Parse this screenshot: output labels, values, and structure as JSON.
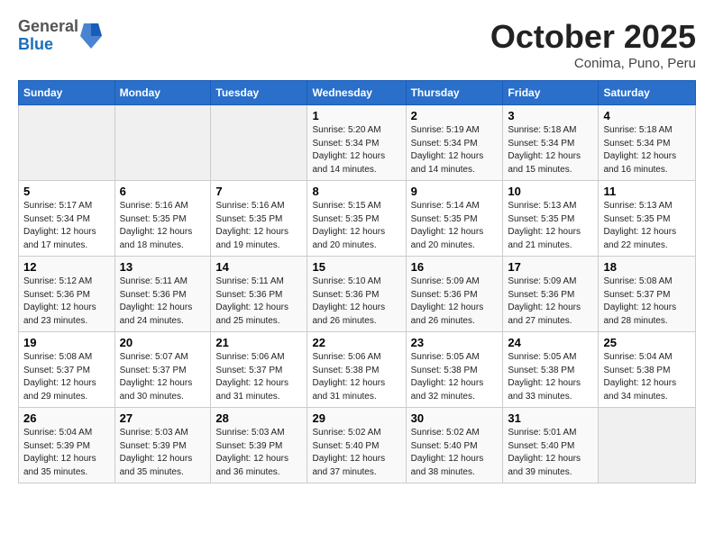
{
  "header": {
    "logo_general": "General",
    "logo_blue": "Blue",
    "month_title": "October 2025",
    "location": "Conima, Puno, Peru"
  },
  "calendar": {
    "days_of_week": [
      "Sunday",
      "Monday",
      "Tuesday",
      "Wednesday",
      "Thursday",
      "Friday",
      "Saturday"
    ],
    "weeks": [
      [
        {
          "day": "",
          "info": ""
        },
        {
          "day": "",
          "info": ""
        },
        {
          "day": "",
          "info": ""
        },
        {
          "day": "1",
          "info": "Sunrise: 5:20 AM\nSunset: 5:34 PM\nDaylight: 12 hours\nand 14 minutes."
        },
        {
          "day": "2",
          "info": "Sunrise: 5:19 AM\nSunset: 5:34 PM\nDaylight: 12 hours\nand 14 minutes."
        },
        {
          "day": "3",
          "info": "Sunrise: 5:18 AM\nSunset: 5:34 PM\nDaylight: 12 hours\nand 15 minutes."
        },
        {
          "day": "4",
          "info": "Sunrise: 5:18 AM\nSunset: 5:34 PM\nDaylight: 12 hours\nand 16 minutes."
        }
      ],
      [
        {
          "day": "5",
          "info": "Sunrise: 5:17 AM\nSunset: 5:34 PM\nDaylight: 12 hours\nand 17 minutes."
        },
        {
          "day": "6",
          "info": "Sunrise: 5:16 AM\nSunset: 5:35 PM\nDaylight: 12 hours\nand 18 minutes."
        },
        {
          "day": "7",
          "info": "Sunrise: 5:16 AM\nSunset: 5:35 PM\nDaylight: 12 hours\nand 19 minutes."
        },
        {
          "day": "8",
          "info": "Sunrise: 5:15 AM\nSunset: 5:35 PM\nDaylight: 12 hours\nand 20 minutes."
        },
        {
          "day": "9",
          "info": "Sunrise: 5:14 AM\nSunset: 5:35 PM\nDaylight: 12 hours\nand 20 minutes."
        },
        {
          "day": "10",
          "info": "Sunrise: 5:13 AM\nSunset: 5:35 PM\nDaylight: 12 hours\nand 21 minutes."
        },
        {
          "day": "11",
          "info": "Sunrise: 5:13 AM\nSunset: 5:35 PM\nDaylight: 12 hours\nand 22 minutes."
        }
      ],
      [
        {
          "day": "12",
          "info": "Sunrise: 5:12 AM\nSunset: 5:36 PM\nDaylight: 12 hours\nand 23 minutes."
        },
        {
          "day": "13",
          "info": "Sunrise: 5:11 AM\nSunset: 5:36 PM\nDaylight: 12 hours\nand 24 minutes."
        },
        {
          "day": "14",
          "info": "Sunrise: 5:11 AM\nSunset: 5:36 PM\nDaylight: 12 hours\nand 25 minutes."
        },
        {
          "day": "15",
          "info": "Sunrise: 5:10 AM\nSunset: 5:36 PM\nDaylight: 12 hours\nand 26 minutes."
        },
        {
          "day": "16",
          "info": "Sunrise: 5:09 AM\nSunset: 5:36 PM\nDaylight: 12 hours\nand 26 minutes."
        },
        {
          "day": "17",
          "info": "Sunrise: 5:09 AM\nSunset: 5:36 PM\nDaylight: 12 hours\nand 27 minutes."
        },
        {
          "day": "18",
          "info": "Sunrise: 5:08 AM\nSunset: 5:37 PM\nDaylight: 12 hours\nand 28 minutes."
        }
      ],
      [
        {
          "day": "19",
          "info": "Sunrise: 5:08 AM\nSunset: 5:37 PM\nDaylight: 12 hours\nand 29 minutes."
        },
        {
          "day": "20",
          "info": "Sunrise: 5:07 AM\nSunset: 5:37 PM\nDaylight: 12 hours\nand 30 minutes."
        },
        {
          "day": "21",
          "info": "Sunrise: 5:06 AM\nSunset: 5:37 PM\nDaylight: 12 hours\nand 31 minutes."
        },
        {
          "day": "22",
          "info": "Sunrise: 5:06 AM\nSunset: 5:38 PM\nDaylight: 12 hours\nand 31 minutes."
        },
        {
          "day": "23",
          "info": "Sunrise: 5:05 AM\nSunset: 5:38 PM\nDaylight: 12 hours\nand 32 minutes."
        },
        {
          "day": "24",
          "info": "Sunrise: 5:05 AM\nSunset: 5:38 PM\nDaylight: 12 hours\nand 33 minutes."
        },
        {
          "day": "25",
          "info": "Sunrise: 5:04 AM\nSunset: 5:38 PM\nDaylight: 12 hours\nand 34 minutes."
        }
      ],
      [
        {
          "day": "26",
          "info": "Sunrise: 5:04 AM\nSunset: 5:39 PM\nDaylight: 12 hours\nand 35 minutes."
        },
        {
          "day": "27",
          "info": "Sunrise: 5:03 AM\nSunset: 5:39 PM\nDaylight: 12 hours\nand 35 minutes."
        },
        {
          "day": "28",
          "info": "Sunrise: 5:03 AM\nSunset: 5:39 PM\nDaylight: 12 hours\nand 36 minutes."
        },
        {
          "day": "29",
          "info": "Sunrise: 5:02 AM\nSunset: 5:40 PM\nDaylight: 12 hours\nand 37 minutes."
        },
        {
          "day": "30",
          "info": "Sunrise: 5:02 AM\nSunset: 5:40 PM\nDaylight: 12 hours\nand 38 minutes."
        },
        {
          "day": "31",
          "info": "Sunrise: 5:01 AM\nSunset: 5:40 PM\nDaylight: 12 hours\nand 39 minutes."
        },
        {
          "day": "",
          "info": ""
        }
      ]
    ]
  }
}
